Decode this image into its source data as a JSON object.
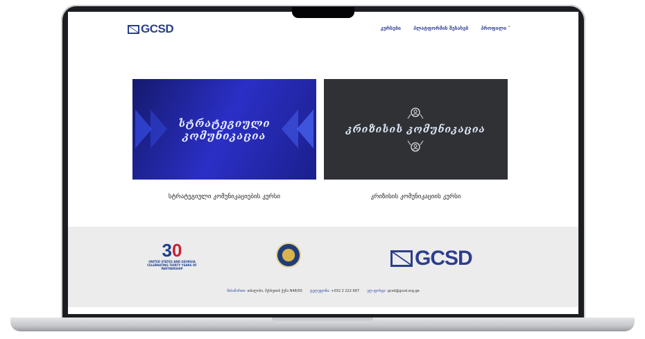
{
  "header": {
    "logo_text": "GCSD",
    "nav": [
      {
        "label": "კურსები"
      },
      {
        "label": "პლატფორმის შესახებ"
      },
      {
        "label": "პროფილი ˅"
      }
    ]
  },
  "courses": [
    {
      "image_title_line1": "სტრატეგიული",
      "image_title_line2": "კომუნიკაცია",
      "caption": "სტრატეგიული კომუნიკაციების კურსი"
    },
    {
      "image_title_line1": "კრიზისის კომუნიკაცია",
      "caption": "კრიზისის კომუნიკაციის კურსი"
    }
  ],
  "footer": {
    "partner_30": {
      "number": "30",
      "line1": "UNITED STATES AND GEORGIA",
      "line2": "CELEBRATING THIRTY YEARS OF PARTNERSHIP"
    },
    "logo_text": "GCSD",
    "contact": {
      "address_label": "მისამართი:",
      "address_value": "თბილისი, მესხეთის ქუჩა N48/50",
      "phone_label": "ტელეფონი:",
      "phone_value": "+032 2 222 667",
      "email_label": "ელ-ფოსტა:",
      "email_value": "gcsd@gcsd.org.ge"
    }
  },
  "colors": {
    "brand": "#2c3e8c",
    "footer_bg": "#ececec",
    "card1_bg": "#2b2fc6",
    "card2_bg": "#2f3135"
  }
}
